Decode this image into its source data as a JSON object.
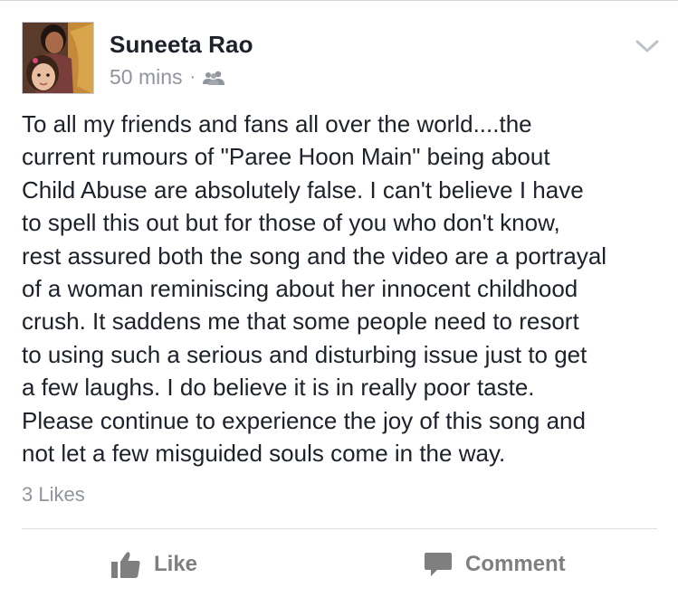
{
  "post": {
    "author_name": "Suneeta Rao",
    "timestamp": "50 mins",
    "separator": "·",
    "audience_icon": "friends-icon",
    "menu_icon": "chevron-down-icon",
    "body": "To all my friends and fans all over the world....the\ncurrent rumours of \"Paree Hoon Main\" being about\nChild Abuse are absolutely false. I can't believe I have\nto spell this out but for those of you who don't know,\nrest assured both the song and the video are a portrayal\nof a woman reminiscing about her innocent childhood\ncrush. It saddens me that some people need to resort\nto using such a serious and disturbing issue just to get\na few laughs. I do believe it is in really poor taste.\nPlease continue to experience the joy of this song and\nnot let a few misguided souls come in the way.",
    "likes_count": "3 Likes"
  },
  "actions": {
    "like_label": "Like",
    "like_icon": "thumbs-up-icon",
    "comment_label": "Comment",
    "comment_icon": "speech-bubble-icon"
  },
  "colors": {
    "text": "#1d2129",
    "secondary": "#90949c",
    "action": "#7f7f7f",
    "divider": "#dddfe2"
  }
}
